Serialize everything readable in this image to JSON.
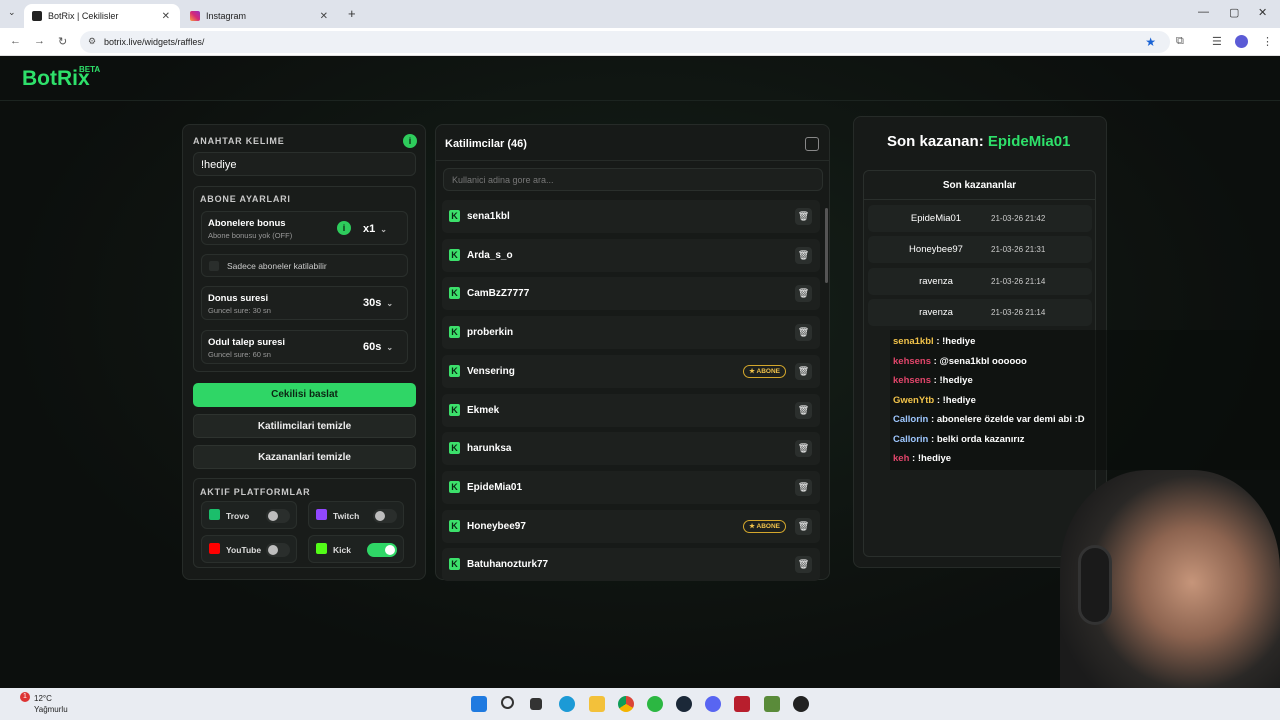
{
  "browser": {
    "tabs": [
      {
        "title": "BotRix | Cekilisler"
      },
      {
        "title": "Instagram"
      }
    ],
    "url": "botrix.live/widgets/raffles/"
  },
  "app": {
    "logo": "BotRix",
    "logo_badge": "BETA"
  },
  "settings": {
    "keyword_label": "ANAHTAR KELIME",
    "keyword_value": "!hediye",
    "sub_settings_label": "ABONE AYARLARI",
    "sub_bonus_title": "Abonelere bonus",
    "sub_bonus_sub": "Abone bonusu yok (OFF)",
    "sub_bonus_value": "x1",
    "only_subs_label": "Sadece aboneler katilabilir",
    "bonus_time_title": "Donus suresi",
    "bonus_time_sub": "Guncel sure: 30 sn",
    "bonus_time_value": "30s",
    "claim_time_title": "Odul talep suresi",
    "claim_time_sub": "Guncel sure: 60 sn",
    "claim_time_value": "60s",
    "start_button": "Cekilisi baslat",
    "clear_participants_button": "Katilimcilari temizle",
    "clear_winners_button": "Kazananlari temizle",
    "platforms_label": "AKTIF PLATFORMLAR",
    "platforms": [
      {
        "name": "Trovo",
        "enabled": false,
        "color": "#1bbe6b"
      },
      {
        "name": "Twitch",
        "enabled": false,
        "color": "#9147ff"
      },
      {
        "name": "YouTube",
        "enabled": false,
        "color": "#ff0000"
      },
      {
        "name": "Kick",
        "enabled": true,
        "color": "#53fc18"
      }
    ]
  },
  "participants": {
    "title": "Katilimcilar (46)",
    "search_placeholder": "Kullanici adina gore ara...",
    "abone_badge": "ABONE",
    "items": [
      {
        "name": "sena1kbl",
        "abone": false
      },
      {
        "name": "Arda_s_o",
        "abone": false
      },
      {
        "name": "CamBzZ7777",
        "abone": false
      },
      {
        "name": "proberkin",
        "abone": false
      },
      {
        "name": "Vensering",
        "abone": true
      },
      {
        "name": "Ekmek",
        "abone": false
      },
      {
        "name": "harunksa",
        "abone": false
      },
      {
        "name": "EpideMia01",
        "abone": false
      },
      {
        "name": "Honeybee97",
        "abone": true
      },
      {
        "name": "Batuhanozturk77",
        "abone": false
      }
    ]
  },
  "winners": {
    "last_winner_prefix": "Son kazanan:",
    "last_winner_name": "EpideMia01",
    "list_title": "Son kazananlar",
    "items": [
      {
        "name": "EpideMia01",
        "date": "21-03-26 21:42"
      },
      {
        "name": "Honeybee97",
        "date": "21-03-26 21:31"
      },
      {
        "name": "ravenza",
        "date": "21-03-26 21:14"
      },
      {
        "name": "ravenza",
        "date": "21-03-26 21:14"
      }
    ]
  },
  "chat_overlay": [
    {
      "user": "sena1kbl",
      "text": ": !hediye",
      "color": "#f0c24a"
    },
    {
      "user": "kehsens",
      "text": ": @sena1kbl oooooo",
      "color": "#e0456a",
      "mention": "@sena1kbl"
    },
    {
      "user": "kehsens",
      "text": ": !hediye",
      "color": "#e0456a"
    },
    {
      "user": "GwenYtb",
      "text": ": !hediye",
      "color": "#f0c24a"
    },
    {
      "user": "Callorin",
      "text": ": abonelere özelde var demi abi :D",
      "color": "#9ec7ff"
    },
    {
      "user": "Callorin",
      "text": ": belki orda kazanırız",
      "color": "#9ec7ff"
    },
    {
      "user": "keh",
      "text": ": !hediye",
      "color": "#e0456a"
    }
  ],
  "taskbar": {
    "temp": "12°C",
    "weather": "Yağmurlu",
    "notif_count": "1"
  }
}
